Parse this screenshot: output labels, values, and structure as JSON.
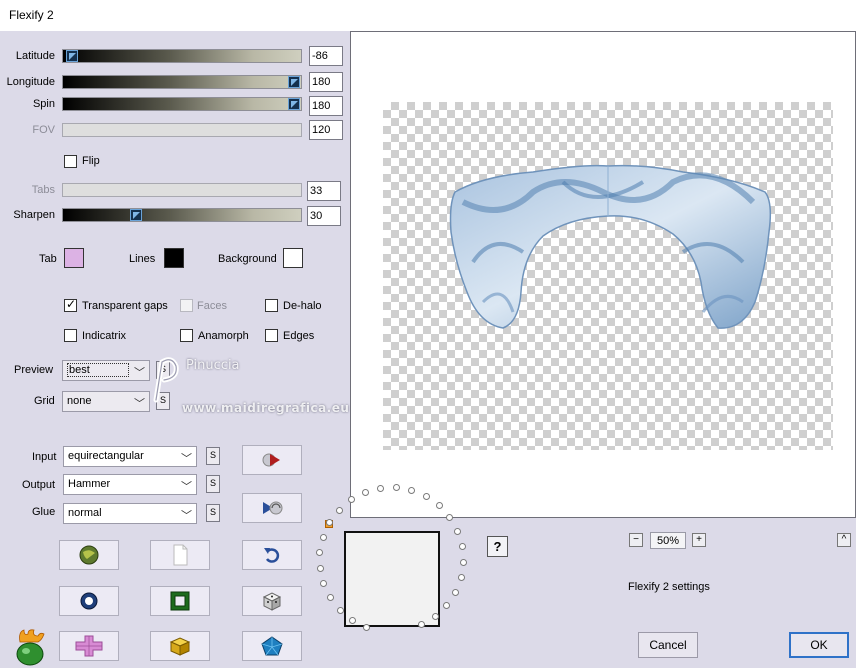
{
  "window": {
    "title": "Flexify 2"
  },
  "sliders": [
    {
      "label": "Latitude",
      "value": "-86",
      "fraction": 0.02,
      "enabled": true
    },
    {
      "label": "Longitude",
      "value": "180",
      "fraction": 0.98,
      "enabled": true
    },
    {
      "label": "Spin",
      "value": "180",
      "fraction": 0.98,
      "enabled": true
    },
    {
      "label": "FOV",
      "value": "120",
      "enabled": false
    },
    {
      "label": "Tabs",
      "value": "33",
      "enabled": false
    },
    {
      "label": "Sharpen",
      "value": "30",
      "fraction": 0.3,
      "enabled": true
    }
  ],
  "flip": {
    "label": "Flip",
    "checked": false
  },
  "colors": {
    "tab": {
      "label": "Tab",
      "color": "#dcb2e4"
    },
    "lines": {
      "label": "Lines",
      "color": "#000000"
    },
    "background": {
      "label": "Background",
      "color": "#ffffff"
    }
  },
  "options": {
    "transparent_gaps": {
      "label": "Transparent gaps",
      "checked": true
    },
    "faces": {
      "label": "Faces",
      "checked": false,
      "enabled": false
    },
    "de_halo": {
      "label": "De-halo",
      "checked": false
    },
    "indicatrix": {
      "label": "Indicatrix",
      "checked": false
    },
    "anamorph": {
      "label": "Anamorph",
      "checked": false
    },
    "edges": {
      "label": "Edges",
      "checked": false
    }
  },
  "preview": {
    "label": "Preview",
    "value": "best"
  },
  "grid": {
    "label": "Grid",
    "value": "none"
  },
  "input": {
    "label": "Input",
    "value": "equirectangular"
  },
  "output": {
    "label": "Output",
    "value": "Hammer"
  },
  "glue": {
    "label": "Glue",
    "value": "normal"
  },
  "s_label": "S",
  "watermark": {
    "name": "Pinuccia",
    "site": "www.maidiregrafica.eu"
  },
  "zoom": {
    "value": "50%",
    "minus": "−",
    "plus": "+"
  },
  "status": "Flexify 2 settings",
  "help": "?",
  "collapse": "^",
  "buttons": {
    "cancel": "Cancel",
    "ok": "OK"
  }
}
